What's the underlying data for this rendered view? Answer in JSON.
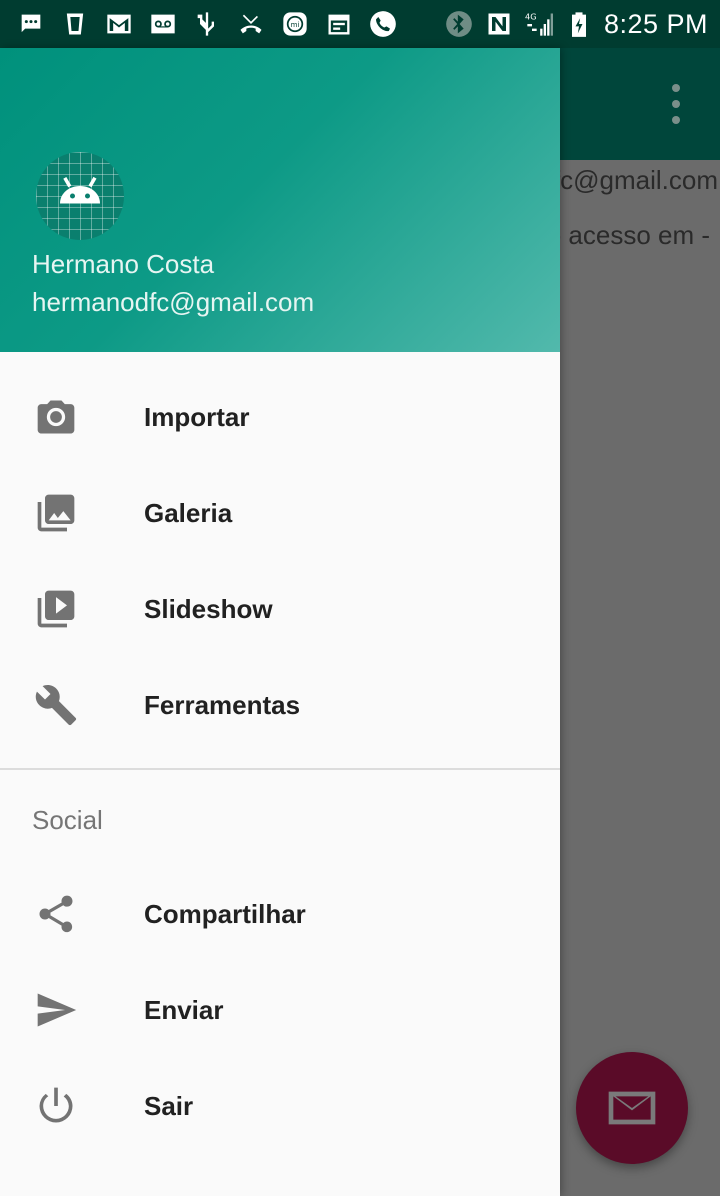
{
  "status_bar": {
    "time": "8:25 PM",
    "left_icons": [
      "chat-bubble-icon",
      "glass-icon",
      "gmail-icon",
      "voicemail-icon",
      "usb-icon",
      "missed-call-icon",
      "mi-icon",
      "calendar-icon",
      "phone-icon"
    ],
    "right_icons": [
      "bluetooth-icon",
      "nfc-icon",
      "4g-signal-icon",
      "battery-charging-icon"
    ]
  },
  "background_app": {
    "email_text": "hermanodfc@gmail.com",
    "access_text": "Último acesso em -"
  },
  "drawer": {
    "header": {
      "user_name": "Hermano Costa",
      "user_email": "hermanodfc@gmail.com"
    },
    "menu": [
      {
        "label": "Importar",
        "icon": "camera-icon"
      },
      {
        "label": "Galeria",
        "icon": "gallery-icon"
      },
      {
        "label": "Slideshow",
        "icon": "slideshow-icon"
      },
      {
        "label": "Ferramentas",
        "icon": "wrench-icon"
      }
    ],
    "section_title": "Social",
    "social_menu": [
      {
        "label": "Compartilhar",
        "icon": "share-icon"
      },
      {
        "label": "Enviar",
        "icon": "send-icon"
      },
      {
        "label": "Sair",
        "icon": "power-icon"
      }
    ]
  },
  "colors": {
    "header_start": "#00917c",
    "header_end": "#52b9ac",
    "status_bar": "#003c30",
    "fab": "#5a0b28",
    "scrim": "#6b6b6b"
  }
}
